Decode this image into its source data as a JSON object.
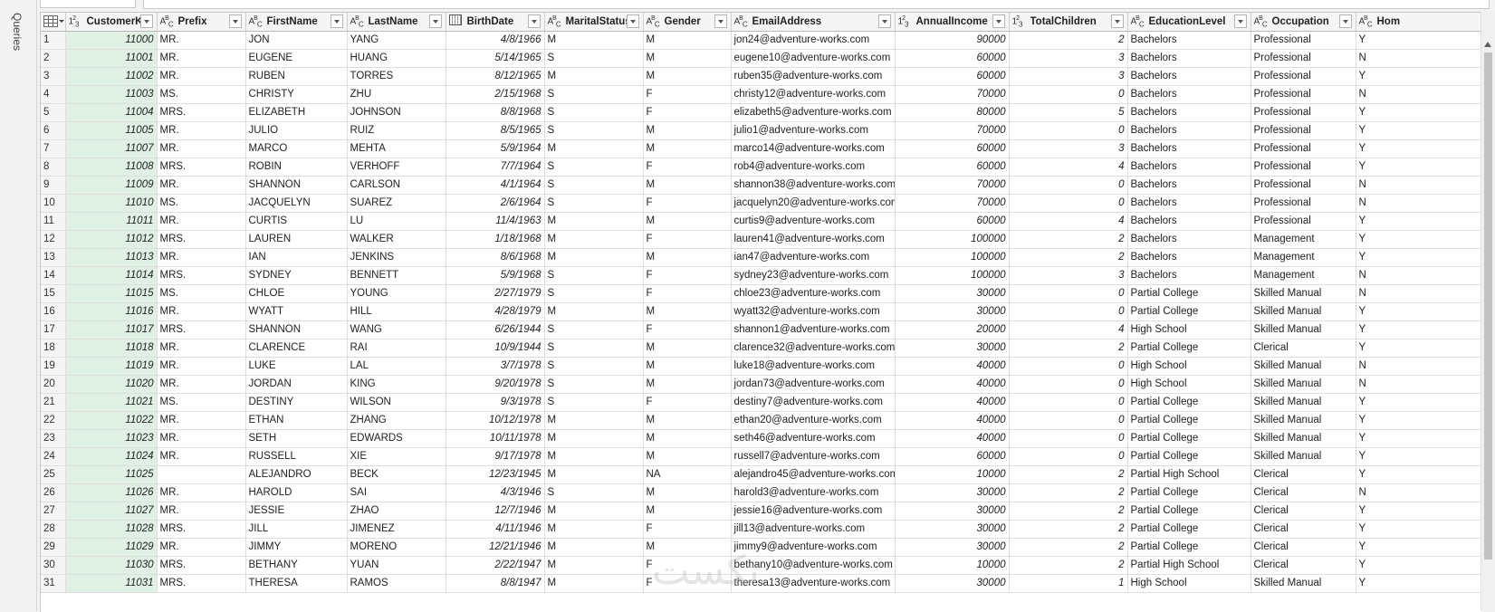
{
  "queries_pane": {
    "label": "Queries"
  },
  "columns": [
    {
      "name": "CustomerKey",
      "type": "num",
      "icon": "1²₃"
    },
    {
      "name": "Prefix",
      "type": "text",
      "icon": "ABC"
    },
    {
      "name": "FirstName",
      "type": "text",
      "icon": "ABC"
    },
    {
      "name": "LastName",
      "type": "text",
      "icon": "ABC"
    },
    {
      "name": "BirthDate",
      "type": "date",
      "icon": "calendar"
    },
    {
      "name": "MaritalStatus",
      "type": "text",
      "icon": "ABC"
    },
    {
      "name": "Gender",
      "type": "text",
      "icon": "ABC"
    },
    {
      "name": "EmailAddress",
      "type": "text",
      "icon": "ABC"
    },
    {
      "name": "AnnualIncome",
      "type": "num",
      "icon": "123"
    },
    {
      "name": "TotalChildren",
      "type": "num",
      "icon": "123"
    },
    {
      "name": "EducationLevel",
      "type": "text",
      "icon": "ABC"
    },
    {
      "name": "Occupation",
      "type": "text",
      "icon": "ABC"
    },
    {
      "name": "Hom",
      "type": "text",
      "icon": "ABC"
    }
  ],
  "rows": [
    [
      "1",
      "11000",
      "MR.",
      "JON",
      "YANG",
      "4/8/1966",
      "M",
      "M",
      "jon24@adventure-works.com",
      "90000",
      "2",
      "Bachelors",
      "Professional",
      "Y"
    ],
    [
      "2",
      "11001",
      "MR.",
      "EUGENE",
      "HUANG",
      "5/14/1965",
      "S",
      "M",
      "eugene10@adventure-works.com",
      "60000",
      "3",
      "Bachelors",
      "Professional",
      "N"
    ],
    [
      "3",
      "11002",
      "MR.",
      "RUBEN",
      "TORRES",
      "8/12/1965",
      "M",
      "M",
      "ruben35@adventure-works.com",
      "60000",
      "3",
      "Bachelors",
      "Professional",
      "Y"
    ],
    [
      "4",
      "11003",
      "MS.",
      "CHRISTY",
      "ZHU",
      "2/15/1968",
      "S",
      "F",
      "christy12@adventure-works.com",
      "70000",
      "0",
      "Bachelors",
      "Professional",
      "N"
    ],
    [
      "5",
      "11004",
      "MRS.",
      "ELIZABETH",
      "JOHNSON",
      "8/8/1968",
      "S",
      "F",
      "elizabeth5@adventure-works.com",
      "80000",
      "5",
      "Bachelors",
      "Professional",
      "Y"
    ],
    [
      "6",
      "11005",
      "MR.",
      "JULIO",
      "RUIZ",
      "8/5/1965",
      "S",
      "M",
      "julio1@adventure-works.com",
      "70000",
      "0",
      "Bachelors",
      "Professional",
      "Y"
    ],
    [
      "7",
      "11007",
      "MR.",
      "MARCO",
      "MEHTA",
      "5/9/1964",
      "M",
      "M",
      "marco14@adventure-works.com",
      "60000",
      "3",
      "Bachelors",
      "Professional",
      "Y"
    ],
    [
      "8",
      "11008",
      "MRS.",
      "ROBIN",
      "VERHOFF",
      "7/7/1964",
      "S",
      "F",
      "rob4@adventure-works.com",
      "60000",
      "4",
      "Bachelors",
      "Professional",
      "Y"
    ],
    [
      "9",
      "11009",
      "MR.",
      "SHANNON",
      "CARLSON",
      "4/1/1964",
      "S",
      "M",
      "shannon38@adventure-works.com",
      "70000",
      "0",
      "Bachelors",
      "Professional",
      "N"
    ],
    [
      "10",
      "11010",
      "MS.",
      "JACQUELYN",
      "SUAREZ",
      "2/6/1964",
      "S",
      "F",
      "jacquelyn20@adventure-works.com",
      "70000",
      "0",
      "Bachelors",
      "Professional",
      "N"
    ],
    [
      "11",
      "11011",
      "MR.",
      "CURTIS",
      "LU",
      "11/4/1963",
      "M",
      "M",
      "curtis9@adventure-works.com",
      "60000",
      "4",
      "Bachelors",
      "Professional",
      "Y"
    ],
    [
      "12",
      "11012",
      "MRS.",
      "LAUREN",
      "WALKER",
      "1/18/1968",
      "M",
      "F",
      "lauren41@adventure-works.com",
      "100000",
      "2",
      "Bachelors",
      "Management",
      "Y"
    ],
    [
      "13",
      "11013",
      "MR.",
      "IAN",
      "JENKINS",
      "8/6/1968",
      "M",
      "M",
      "ian47@adventure-works.com",
      "100000",
      "2",
      "Bachelors",
      "Management",
      "Y"
    ],
    [
      "14",
      "11014",
      "MRS.",
      "SYDNEY",
      "BENNETT",
      "5/9/1968",
      "S",
      "F",
      "sydney23@adventure-works.com",
      "100000",
      "3",
      "Bachelors",
      "Management",
      "N"
    ],
    [
      "15",
      "11015",
      "MS.",
      "CHLOE",
      "YOUNG",
      "2/27/1979",
      "S",
      "F",
      "chloe23@adventure-works.com",
      "30000",
      "0",
      "Partial College",
      "Skilled Manual",
      "N"
    ],
    [
      "16",
      "11016",
      "MR.",
      "WYATT",
      "HILL",
      "4/28/1979",
      "M",
      "M",
      "wyatt32@adventure-works.com",
      "30000",
      "0",
      "Partial College",
      "Skilled Manual",
      "Y"
    ],
    [
      "17",
      "11017",
      "MRS.",
      "SHANNON",
      "WANG",
      "6/26/1944",
      "S",
      "F",
      "shannon1@adventure-works.com",
      "20000",
      "4",
      "High School",
      "Skilled Manual",
      "Y"
    ],
    [
      "18",
      "11018",
      "MR.",
      "CLARENCE",
      "RAI",
      "10/9/1944",
      "S",
      "M",
      "clarence32@adventure-works.com",
      "30000",
      "2",
      "Partial College",
      "Clerical",
      "Y"
    ],
    [
      "19",
      "11019",
      "MR.",
      "LUKE",
      "LAL",
      "3/7/1978",
      "S",
      "M",
      "luke18@adventure-works.com",
      "40000",
      "0",
      "High School",
      "Skilled Manual",
      "N"
    ],
    [
      "20",
      "11020",
      "MR.",
      "JORDAN",
      "KING",
      "9/20/1978",
      "S",
      "M",
      "jordan73@adventure-works.com",
      "40000",
      "0",
      "High School",
      "Skilled Manual",
      "N"
    ],
    [
      "21",
      "11021",
      "MS.",
      "DESTINY",
      "WILSON",
      "9/3/1978",
      "S",
      "F",
      "destiny7@adventure-works.com",
      "40000",
      "0",
      "Partial College",
      "Skilled Manual",
      "Y"
    ],
    [
      "22",
      "11022",
      "MR.",
      "ETHAN",
      "ZHANG",
      "10/12/1978",
      "M",
      "M",
      "ethan20@adventure-works.com",
      "40000",
      "0",
      "Partial College",
      "Skilled Manual",
      "Y"
    ],
    [
      "23",
      "11023",
      "MR.",
      "SETH",
      "EDWARDS",
      "10/11/1978",
      "M",
      "M",
      "seth46@adventure-works.com",
      "40000",
      "0",
      "Partial College",
      "Skilled Manual",
      "Y"
    ],
    [
      "24",
      "11024",
      "MR.",
      "RUSSELL",
      "XIE",
      "9/17/1978",
      "M",
      "M",
      "russell7@adventure-works.com",
      "60000",
      "0",
      "Partial College",
      "Skilled Manual",
      "Y"
    ],
    [
      "25",
      "11025",
      "",
      "ALEJANDRO",
      "BECK",
      "12/23/1945",
      "M",
      "NA",
      "alejandro45@adventure-works.com",
      "10000",
      "2",
      "Partial High School",
      "Clerical",
      "Y"
    ],
    [
      "26",
      "11026",
      "MR.",
      "HAROLD",
      "SAI",
      "4/3/1946",
      "S",
      "M",
      "harold3@adventure-works.com",
      "30000",
      "2",
      "Partial College",
      "Clerical",
      "N"
    ],
    [
      "27",
      "11027",
      "MR.",
      "JESSIE",
      "ZHAO",
      "12/7/1946",
      "M",
      "M",
      "jessie16@adventure-works.com",
      "30000",
      "2",
      "Partial College",
      "Clerical",
      "Y"
    ],
    [
      "28",
      "11028",
      "MRS.",
      "JILL",
      "JIMENEZ",
      "4/11/1946",
      "M",
      "F",
      "jill13@adventure-works.com",
      "30000",
      "2",
      "Partial College",
      "Clerical",
      "Y"
    ],
    [
      "29",
      "11029",
      "MR.",
      "JIMMY",
      "MORENO",
      "12/21/1946",
      "M",
      "M",
      "jimmy9@adventure-works.com",
      "30000",
      "2",
      "Partial College",
      "Clerical",
      "Y"
    ],
    [
      "30",
      "11030",
      "MRS.",
      "BETHANY",
      "YUAN",
      "2/22/1947",
      "M",
      "F",
      "bethany10@adventure-works.com",
      "10000",
      "2",
      "Partial High School",
      "Clerical",
      "Y"
    ],
    [
      "31",
      "11031",
      "MRS.",
      "THERESA",
      "RAMOS",
      "8/8/1947",
      "M",
      "F",
      "theresa13@adventure-works.com",
      "30000",
      "1",
      "High School",
      "Skilled Manual",
      "Y"
    ]
  ],
  "colors": {
    "key_column_bg": "#dff0e5",
    "header_bg": "#f5f5f5",
    "grid_line": "#dedede"
  }
}
